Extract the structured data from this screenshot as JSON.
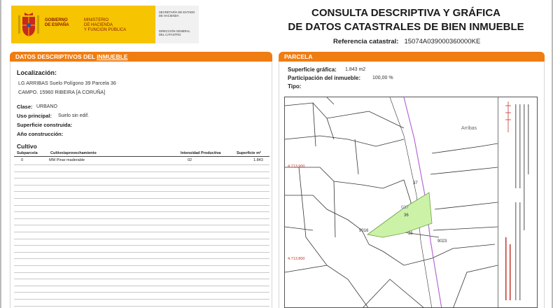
{
  "header": {
    "gov_line1": "GOBIERNO",
    "gov_line2": "DE ESPAÑA",
    "min_line1": "MINISTERIO",
    "min_line2": "DE HACIENDA",
    "min_line3": "Y FUNCIÓN PÚBLICA",
    "sec_line1": "SECRETARÍA DE ESTADO",
    "sec_line2": "DE HACIENDA",
    "dir_line1": "DIRECCIÓN GENERAL",
    "dir_line2": "DEL CATASTRO",
    "title_line1": "CONSULTA DESCRIPTIVA Y GRÁFICA",
    "title_line2": "DE DATOS CATASTRALES DE BIEN INMUEBLE",
    "ref_label": "Referencia catastral:",
    "ref_value": "15074A039000360000KE"
  },
  "left": {
    "bar_prefix": "DATOS DESCRIPTIVOS DEL ",
    "bar_highlight": "INMUEBLE",
    "loc_label": "Localización:",
    "loc_line1": "LG ARRIBAS  Suelo Polígono 39 Parcela 36",
    "loc_line2": "CAMPO. 15960 RIBEIRA [A CORUÑA]",
    "clase_label": "Clase:",
    "clase_value": "URBANO",
    "uso_label": "Uso principal:",
    "uso_value": "Suelo sin edif.",
    "sup_label": "Superficie construida:",
    "anio_label": "Año construcción:",
    "cultivo_label": "Cultivo",
    "columns": [
      "Subparcela",
      "Cultivo/aprovechamiento",
      "Intensidad Productiva",
      "Superficie m²"
    ],
    "rows": [
      [
        "0",
        "MM Pinar maderable",
        "02",
        "1.843"
      ]
    ]
  },
  "right": {
    "bar_label": "PARCELA",
    "sg_label": "Superficie gráfica:",
    "sg_value": "1.843 m2",
    "part_label": "Participación del inmueble:",
    "part_value": "100,00 %",
    "tipo_label": "Tipo:"
  },
  "map": {
    "place_name": "Arribas",
    "coord_top": "4.713.900",
    "coord_bottom": "4.713.800",
    "parcel_labels": [
      "037",
      "36",
      "37",
      "9016",
      "35",
      "9023"
    ],
    "highlight_color": "#ccf2a8",
    "road_color": "#b46ad8"
  },
  "colors": {
    "orange": "#ef7d12",
    "gold": "#f6c400"
  }
}
